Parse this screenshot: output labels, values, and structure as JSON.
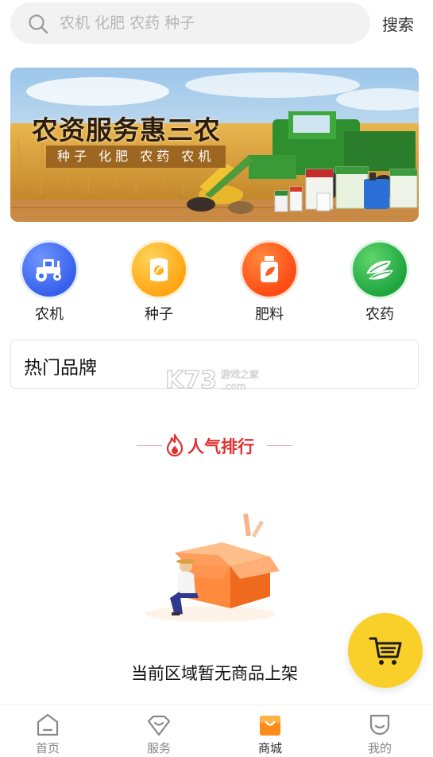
{
  "search": {
    "placeholder": "农机 化肥 农药 种子",
    "button_label": "搜索"
  },
  "banner": {
    "title": "农资服务惠三农",
    "subtitle": "种子 化肥 农药 农机"
  },
  "categories": [
    {
      "label": "农机",
      "icon": "tractor-icon",
      "color": "#3f6ff2"
    },
    {
      "label": "种子",
      "icon": "seed-bag-icon",
      "color": "#ffb21a"
    },
    {
      "label": "肥料",
      "icon": "fertilizer-bottle-icon",
      "color": "#ff5a1f"
    },
    {
      "label": "农药",
      "icon": "leaf-icon",
      "color": "#27b34a"
    }
  ],
  "hot_brands": {
    "title": "热门品牌"
  },
  "watermark": {
    "brand": "K73",
    "caption": "游戏之家",
    "domain": ".com"
  },
  "ranking": {
    "title": "人气排行",
    "accent": "#e03030"
  },
  "empty_state": {
    "message": "当前区域暂无商品上架"
  },
  "cart": {
    "icon": "cart-icon",
    "color": "#f9cf2a"
  },
  "tabbar": {
    "tabs": [
      {
        "label": "首页",
        "icon": "home-icon",
        "active": false
      },
      {
        "label": "服务",
        "icon": "service-icon",
        "active": false
      },
      {
        "label": "商城",
        "icon": "mall-icon",
        "active": true
      },
      {
        "label": "我的",
        "icon": "profile-icon",
        "active": false
      }
    ]
  }
}
